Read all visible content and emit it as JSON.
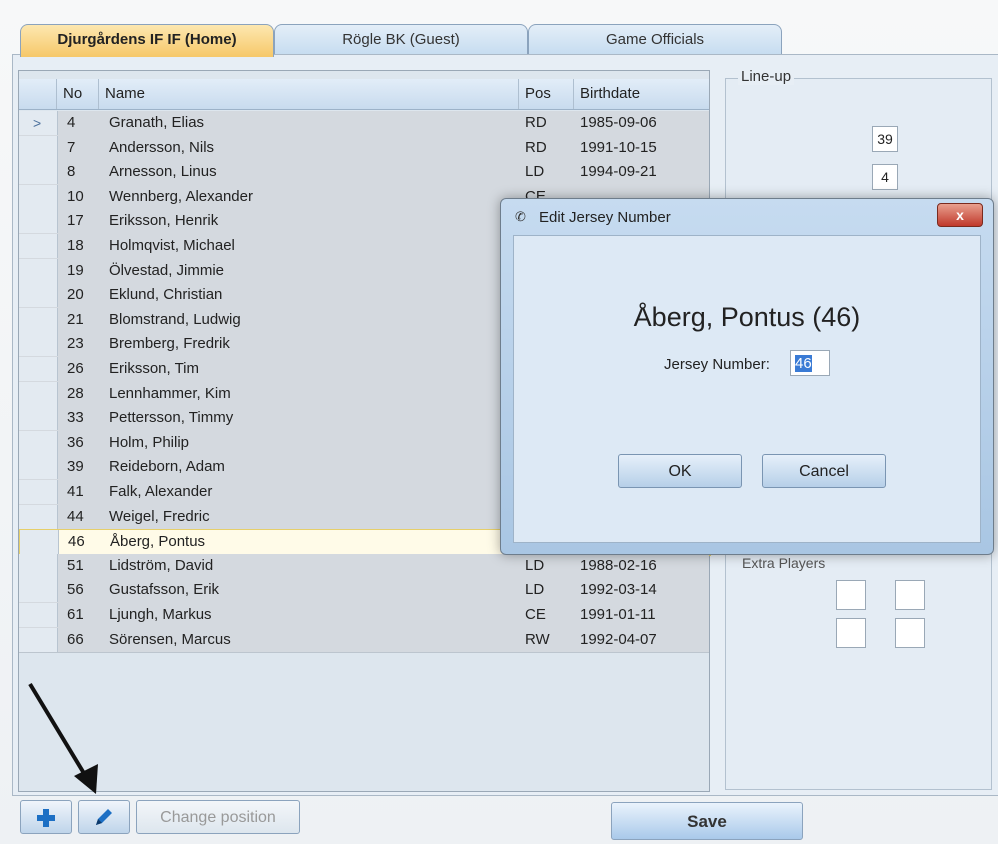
{
  "tabs": [
    {
      "label": "Djurgårdens IF IF (Home)"
    },
    {
      "label": "Rögle BK (Guest)"
    },
    {
      "label": "Game Officials"
    }
  ],
  "grid": {
    "columns": [
      "No",
      "Name",
      "Pos",
      "Birthdate"
    ],
    "rows": [
      {
        "no": "4",
        "name": "Granath, Elias",
        "pos": "RD",
        "birthdate": "1985-09-06"
      },
      {
        "no": "7",
        "name": "Andersson, Nils",
        "pos": "RD",
        "birthdate": "1991-10-15"
      },
      {
        "no": "8",
        "name": "Arnesson, Linus",
        "pos": "LD",
        "birthdate": "1994-09-21"
      },
      {
        "no": "10",
        "name": "Wennberg, Alexander",
        "pos": "CE",
        "birthdate": ""
      },
      {
        "no": "17",
        "name": "Eriksson, Henrik",
        "pos": "",
        "birthdate": ""
      },
      {
        "no": "18",
        "name": "Holmqvist, Michael",
        "pos": "",
        "birthdate": ""
      },
      {
        "no": "19",
        "name": "Ölvestad, Jimmie",
        "pos": "",
        "birthdate": ""
      },
      {
        "no": "20",
        "name": "Eklund, Christian",
        "pos": "",
        "birthdate": ""
      },
      {
        "no": "21",
        "name": "Blomstrand, Ludwig",
        "pos": "",
        "birthdate": ""
      },
      {
        "no": "23",
        "name": "Bremberg, Fredrik",
        "pos": "",
        "birthdate": ""
      },
      {
        "no": "26",
        "name": "Eriksson, Tim",
        "pos": "",
        "birthdate": ""
      },
      {
        "no": "28",
        "name": "Lennhammer, Kim",
        "pos": "",
        "birthdate": ""
      },
      {
        "no": "33",
        "name": "Pettersson, Timmy",
        "pos": "",
        "birthdate": ""
      },
      {
        "no": "36",
        "name": "Holm, Philip",
        "pos": "",
        "birthdate": ""
      },
      {
        "no": "39",
        "name": "Reideborn, Adam",
        "pos": "",
        "birthdate": ""
      },
      {
        "no": "41",
        "name": "Falk, Alexander",
        "pos": "",
        "birthdate": ""
      },
      {
        "no": "44",
        "name": "Weigel, Fredric",
        "pos": "",
        "birthdate": ""
      },
      {
        "no": "46",
        "name": "Åberg, Pontus",
        "pos": "",
        "birthdate": ""
      },
      {
        "no": "51",
        "name": "Lidström, David",
        "pos": "LD",
        "birthdate": "1988-02-16"
      },
      {
        "no": "56",
        "name": "Gustafsson, Erik",
        "pos": "LD",
        "birthdate": "1992-03-14"
      },
      {
        "no": "61",
        "name": "Ljungh, Markus",
        "pos": "CE",
        "birthdate": "1991-01-11"
      },
      {
        "no": "66",
        "name": "Sörensen, Marcus",
        "pos": "RW",
        "birthdate": "1992-04-07"
      }
    ],
    "selected_index": 17,
    "current_index": 0
  },
  "lineup": {
    "label": "Line-up",
    "numbers": [
      "39",
      "4"
    ],
    "extra_label": "Extra Players"
  },
  "toolbar": {
    "add_icon": "plus-icon",
    "edit_icon": "pencil-icon",
    "change_position_label": "Change position",
    "save_label": "Save"
  },
  "dialog": {
    "title": "Edit Jersey Number",
    "close_label": "x",
    "player_label": "Åberg, Pontus (46)",
    "jersey_label": "Jersey Number:",
    "jersey_value": "46",
    "ok_label": "OK",
    "cancel_label": "Cancel"
  }
}
